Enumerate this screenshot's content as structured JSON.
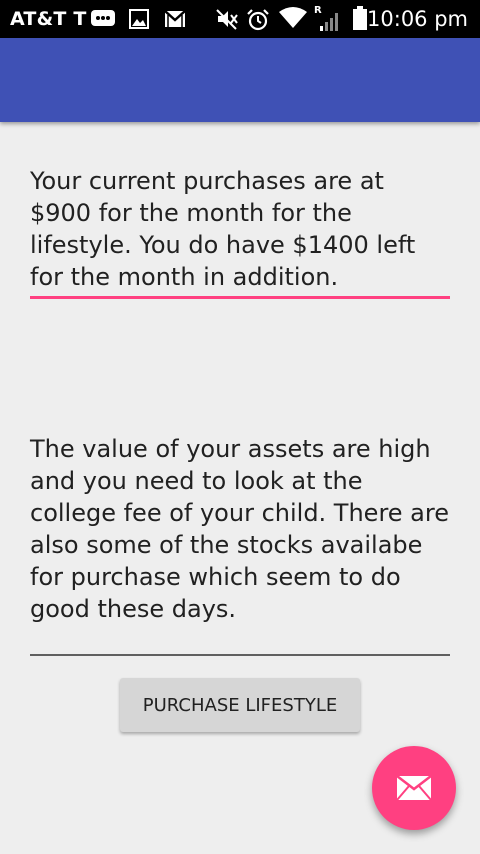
{
  "status_bar": {
    "carrier": "AT&T T",
    "time": "10:06 pm",
    "signal_label": "R",
    "icons": [
      "messaging-icon",
      "gallery-icon",
      "gmail-icon",
      "mute-icon",
      "alarm-icon",
      "wifi-icon",
      "signal-icon",
      "battery-icon"
    ]
  },
  "app_bar": {
    "color": "#3f51b5"
  },
  "main": {
    "purchases_text": "Your current purchases are at $900 for the month for the lifestyle. You do have $1400 left for the month in addition.",
    "assets_text": "The value of your assets are high and you need to look at the college fee of your child. There are also some of the stocks availabe for purchase which seem to do good these days.",
    "purchase_button_label": "PURCHASE LIFESTYLE"
  },
  "fab": {
    "icon": "email-icon",
    "color": "#ff4081"
  }
}
